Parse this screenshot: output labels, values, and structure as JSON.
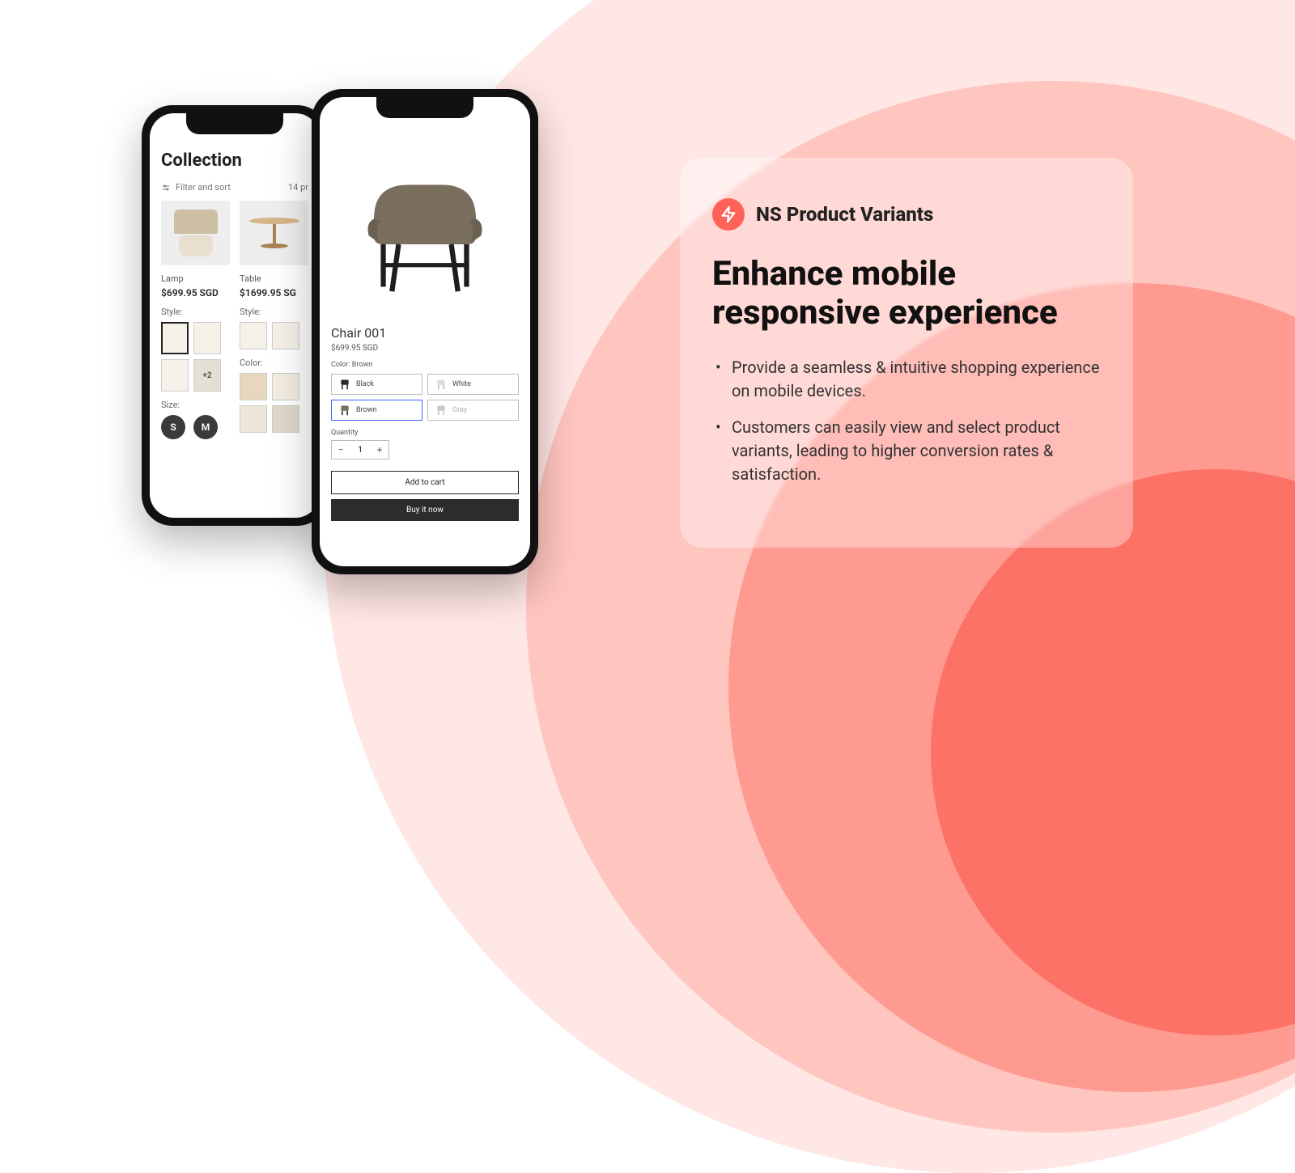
{
  "brand": {
    "name": "NS Product Variants"
  },
  "headline": "Enhance mobile responsive experience",
  "bullets": [
    "Provide a seamless & intuitive shopping experience on mobile devices.",
    "Customers can easily view and select product variants, leading to higher conversion rates & satisfaction."
  ],
  "collection": {
    "title": "Collection",
    "filter_sort": "Filter and sort",
    "count_label": "14 pr",
    "products": [
      {
        "name": "Lamp",
        "price": "$699.95 SGD",
        "style_label": "Style:",
        "size_label": "Size:",
        "more": "+2",
        "sizes": [
          "S",
          "M"
        ]
      },
      {
        "name": "Table",
        "price": "$1699.95 SG",
        "style_label": "Style:",
        "color_label": "Color:"
      }
    ]
  },
  "product": {
    "name": "Chair 001",
    "price": "$699.95 SGD",
    "color_label": "Color: Brown",
    "colors": [
      {
        "name": "Black",
        "selected": false
      },
      {
        "name": "White",
        "selected": false
      },
      {
        "name": "Brown",
        "selected": true
      },
      {
        "name": "Gray",
        "selected": false
      }
    ],
    "quantity_label": "Quantity",
    "quantity": "1",
    "minus": "−",
    "plus": "+",
    "add_to_cart": "Add to cart",
    "buy_now": "Buy it now"
  }
}
